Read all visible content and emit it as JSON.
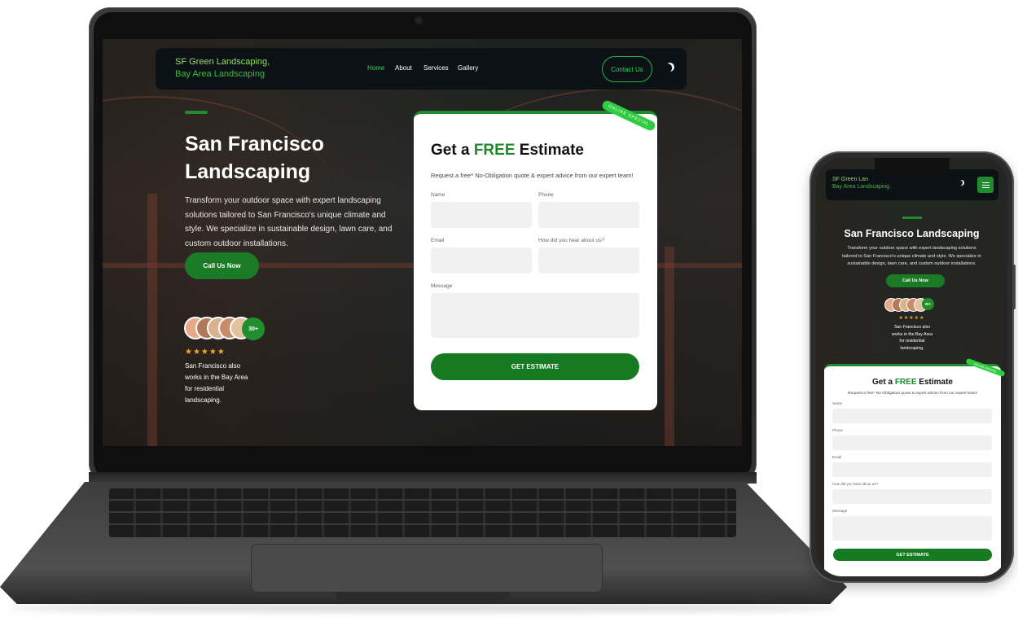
{
  "site": {
    "brand_line1": "SF  Green Landscaping,",
    "brand_line2": "Bay Area Landscaping"
  },
  "nav": {
    "links": [
      {
        "label": "Home",
        "active": true
      },
      {
        "label": "About",
        "active": false
      },
      {
        "label": "Services",
        "active": false
      },
      {
        "label": "Gallery",
        "active": false
      }
    ],
    "contact_label": "Contact Us",
    "theme_toggle_icon": "moon-icon"
  },
  "hero": {
    "title": "San Francisco Landscaping",
    "description": "Transform your outdoor space with expert landscaping solutions tailored to San Francisco's unique climate and style. We specialize in sustainable design, lawn care, and custom outdoor installations.",
    "cta_label": "Call Us Now",
    "avatar_count": "30+",
    "stars": "★★★★★",
    "review_text": "San Francisco also works in the Bay Area for residential landscaping."
  },
  "form": {
    "ribbon": "ONLINE SPECIAL",
    "title_prefix": "Get a ",
    "title_highlight": "FREE",
    "title_suffix": " Estimate",
    "subtitle": "Request a free* No-Obligation quote & expert advice from our expert team!",
    "fields": {
      "name": "Name",
      "phone": "Phone",
      "email": "Email",
      "source": "How did you hear about us?",
      "message": "Message"
    },
    "submit_label": "GET ESTIMATE"
  },
  "mobile": {
    "brand_line1": "SF  Green Lan",
    "brand_line2": "Bay Area Landscaping",
    "title": "San Francisco Landscaping",
    "description": "Transform your outdoor space with expert landscaping solutions tailored to San Francisco's unique climate and style. We specialize in sustainable design, lawn care, and custom outdoor installations.",
    "cta_label": "Call Us Now",
    "avatar_count": "30+",
    "stars": "★★★★★",
    "review_text": "San Francisco also works in the Bay Area for residential landscaping.",
    "ribbon": "ONLINE SPECIAL",
    "form_title_prefix": "Get a ",
    "form_title_highlight": "FREE",
    "form_title_suffix": " Estimate",
    "form_subtitle": "Request a free* No-Obligation quote & expert advice from our expert team!",
    "fields": [
      "Name",
      "Phone",
      "Email",
      "How did you hear about us?",
      "Message"
    ],
    "submit_label": "GET ESTIMATE"
  },
  "colors": {
    "brand_green": "#1f8a2e",
    "accent_green": "#2ecc40",
    "star": "#f5a623",
    "nav_bg": "#0b1114"
  }
}
